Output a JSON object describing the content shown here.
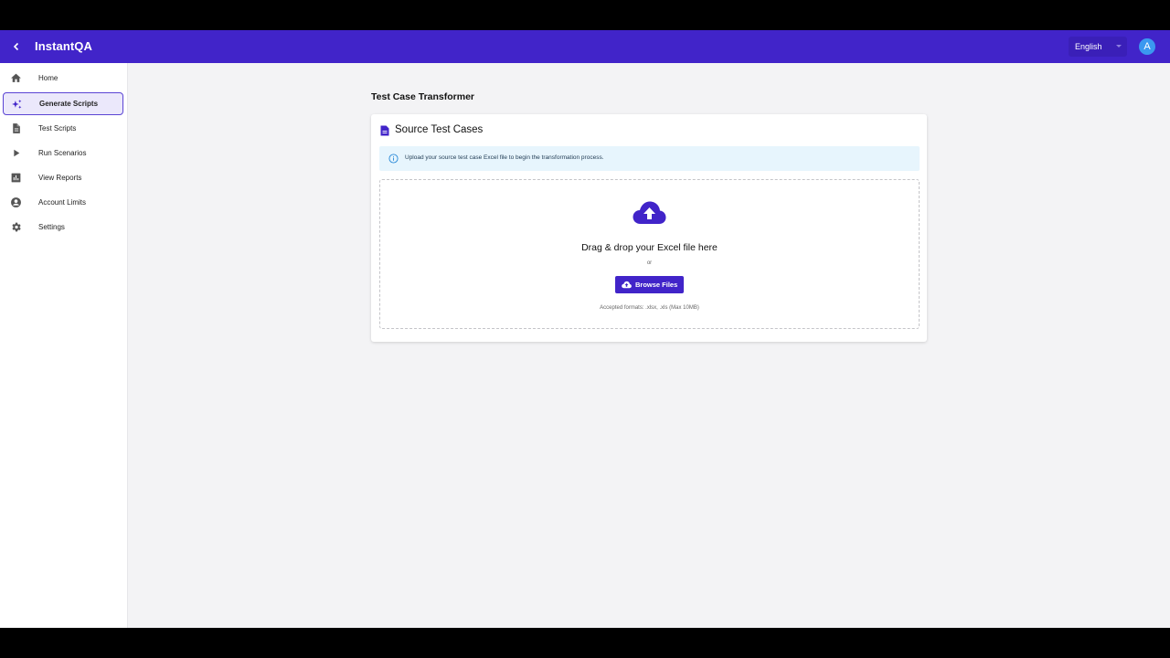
{
  "app": {
    "title": "InstantQA",
    "language": "English",
    "avatar_initial": "A",
    "brand_color": "#4124c9"
  },
  "sidebar": {
    "items": [
      {
        "label": "Home",
        "icon": "home-icon",
        "active": false
      },
      {
        "label": "Generate Scripts",
        "icon": "sparkle-icon",
        "active": true
      },
      {
        "label": "Test Scripts",
        "icon": "document-icon",
        "active": false
      },
      {
        "label": "Run Scenarios",
        "icon": "play-icon",
        "active": false
      },
      {
        "label": "View Reports",
        "icon": "bar-chart-icon",
        "active": false
      },
      {
        "label": "Account Limits",
        "icon": "account-icon",
        "active": false
      },
      {
        "label": "Settings",
        "icon": "gear-icon",
        "active": false
      }
    ]
  },
  "main": {
    "heading": "Test Case Transformer",
    "card": {
      "title": "Source Test Cases",
      "info_text": "Upload your source test case Excel file to begin the transformation process.",
      "dropzone": {
        "title": "Drag & drop your Excel file here",
        "or": "or",
        "button_label": "Browse Files",
        "formats": "Accepted formats: .xlsx, .xls (Max 10MB)"
      }
    }
  }
}
